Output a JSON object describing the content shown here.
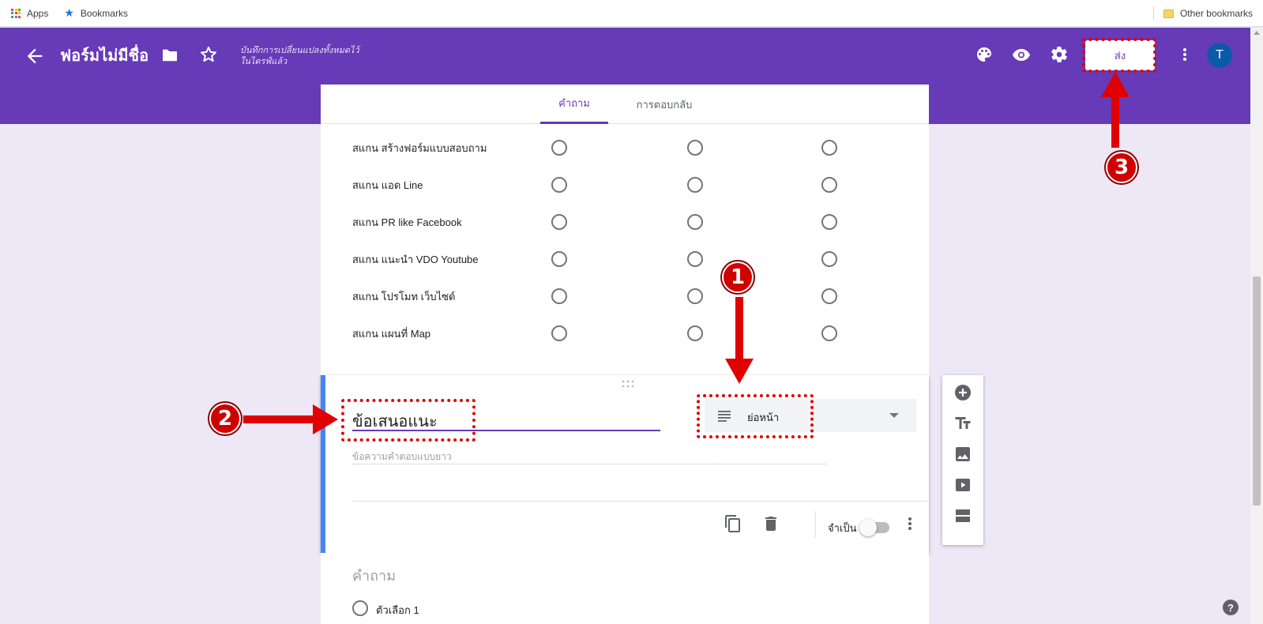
{
  "bookmarks_bar": {
    "apps_label": "Apps",
    "bookmarks_label": "Bookmarks",
    "other_bookmarks_label": "Other bookmarks"
  },
  "header": {
    "title": "ฟอร์มไม่มีชื่อ",
    "saved_status_line1": "บันทึกการเปลี่ยนแปลงทั้งหมดไว้",
    "saved_status_line2": "ในไดรฟ์แล้ว",
    "send_label": "ส่ง",
    "avatar_letter": "T",
    "color": "#673ab7"
  },
  "tabs": [
    {
      "label": "คำถาม",
      "active": true
    },
    {
      "label": "การตอบกลับ",
      "active": false
    }
  ],
  "grid_rows": [
    "สแกน สร้างฟอร์มแบบสอบถาม",
    "สแกน แอด Line",
    "สแกน PR like Facebook",
    "สแกน แนะนำ VDO Youtube",
    "สแกน โปรโมท เว็บไซด์",
    "สแกน แผนที่ Map"
  ],
  "question_card": {
    "title": "ข้อเสนอแนะ",
    "type_label": "ย่อหน้า",
    "answer_hint": "ข้อความคำตอบแบบยาว",
    "required_label": "จำเป็น",
    "required": false
  },
  "next_card": {
    "question_placeholder": "คำถาม",
    "option_label": "ตัวเลือก 1"
  },
  "annotations": {
    "badge1": "1",
    "badge2": "2",
    "badge3": "3",
    "color": "#e00000"
  },
  "help_label": "?"
}
